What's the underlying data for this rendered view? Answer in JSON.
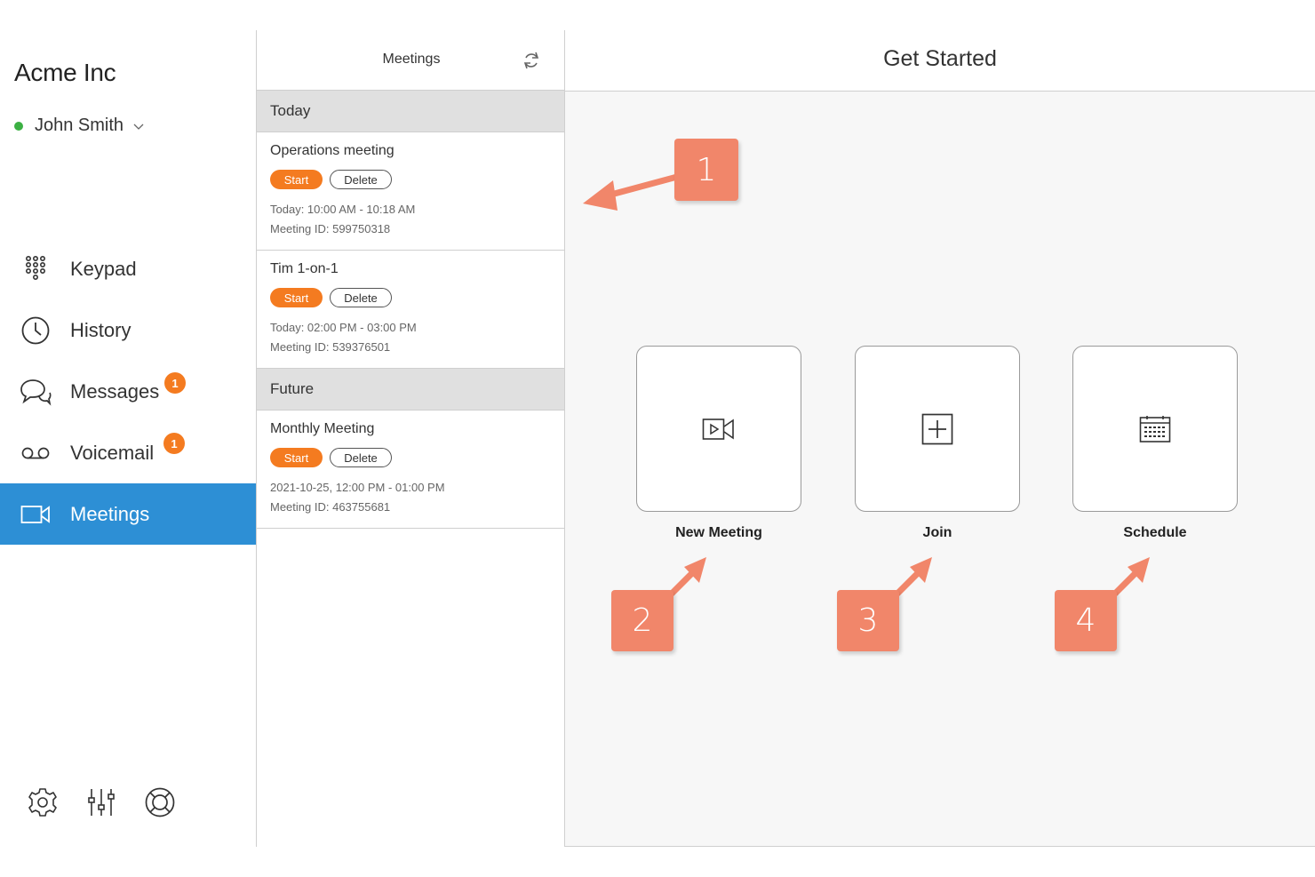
{
  "sidebar": {
    "company": "Acme Inc",
    "user_name": "John Smith",
    "status_color": "#3cb043",
    "nav": [
      {
        "label": "Keypad",
        "icon": "keypad-icon"
      },
      {
        "label": "History",
        "icon": "clock-icon"
      },
      {
        "label": "Messages",
        "icon": "chat-bubbles-icon",
        "badge": "1"
      },
      {
        "label": "Voicemail",
        "icon": "voicemail-icon",
        "badge": "1"
      },
      {
        "label": "Meetings",
        "icon": "video-camera-icon",
        "active": true
      }
    ],
    "bottom_icons": [
      "gear-icon",
      "sliders-icon",
      "lifebuoy-icon"
    ]
  },
  "meetings_panel": {
    "title": "Meetings",
    "sections": [
      {
        "label": "Today",
        "meetings": [
          {
            "title": "Operations meeting",
            "start_label": "Start",
            "delete_label": "Delete",
            "time": "Today: 10:00 AM - 10:18 AM",
            "meeting_id": "Meeting ID: 599750318"
          },
          {
            "title": "Tim 1-on-1",
            "start_label": "Start",
            "delete_label": "Delete",
            "time": "Today: 02:00 PM - 03:00 PM",
            "meeting_id": "Meeting ID: 539376501"
          }
        ]
      },
      {
        "label": "Future",
        "meetings": [
          {
            "title": "Monthly Meeting",
            "start_label": "Start",
            "delete_label": "Delete",
            "time": "2021-10-25, 12:00 PM - 01:00 PM",
            "meeting_id": "Meeting ID: 463755681"
          }
        ]
      }
    ]
  },
  "main": {
    "title": "Get Started",
    "actions": [
      {
        "label": "New Meeting",
        "icon": "video-camera-icon"
      },
      {
        "label": "Join",
        "icon": "plus-square-icon"
      },
      {
        "label": "Schedule",
        "icon": "calendar-icon"
      }
    ]
  },
  "callouts": [
    "1",
    "2",
    "3",
    "4"
  ],
  "colors": {
    "accent": "#2d8fd5",
    "orange": "#f47b20",
    "callout": "#f1866a"
  }
}
